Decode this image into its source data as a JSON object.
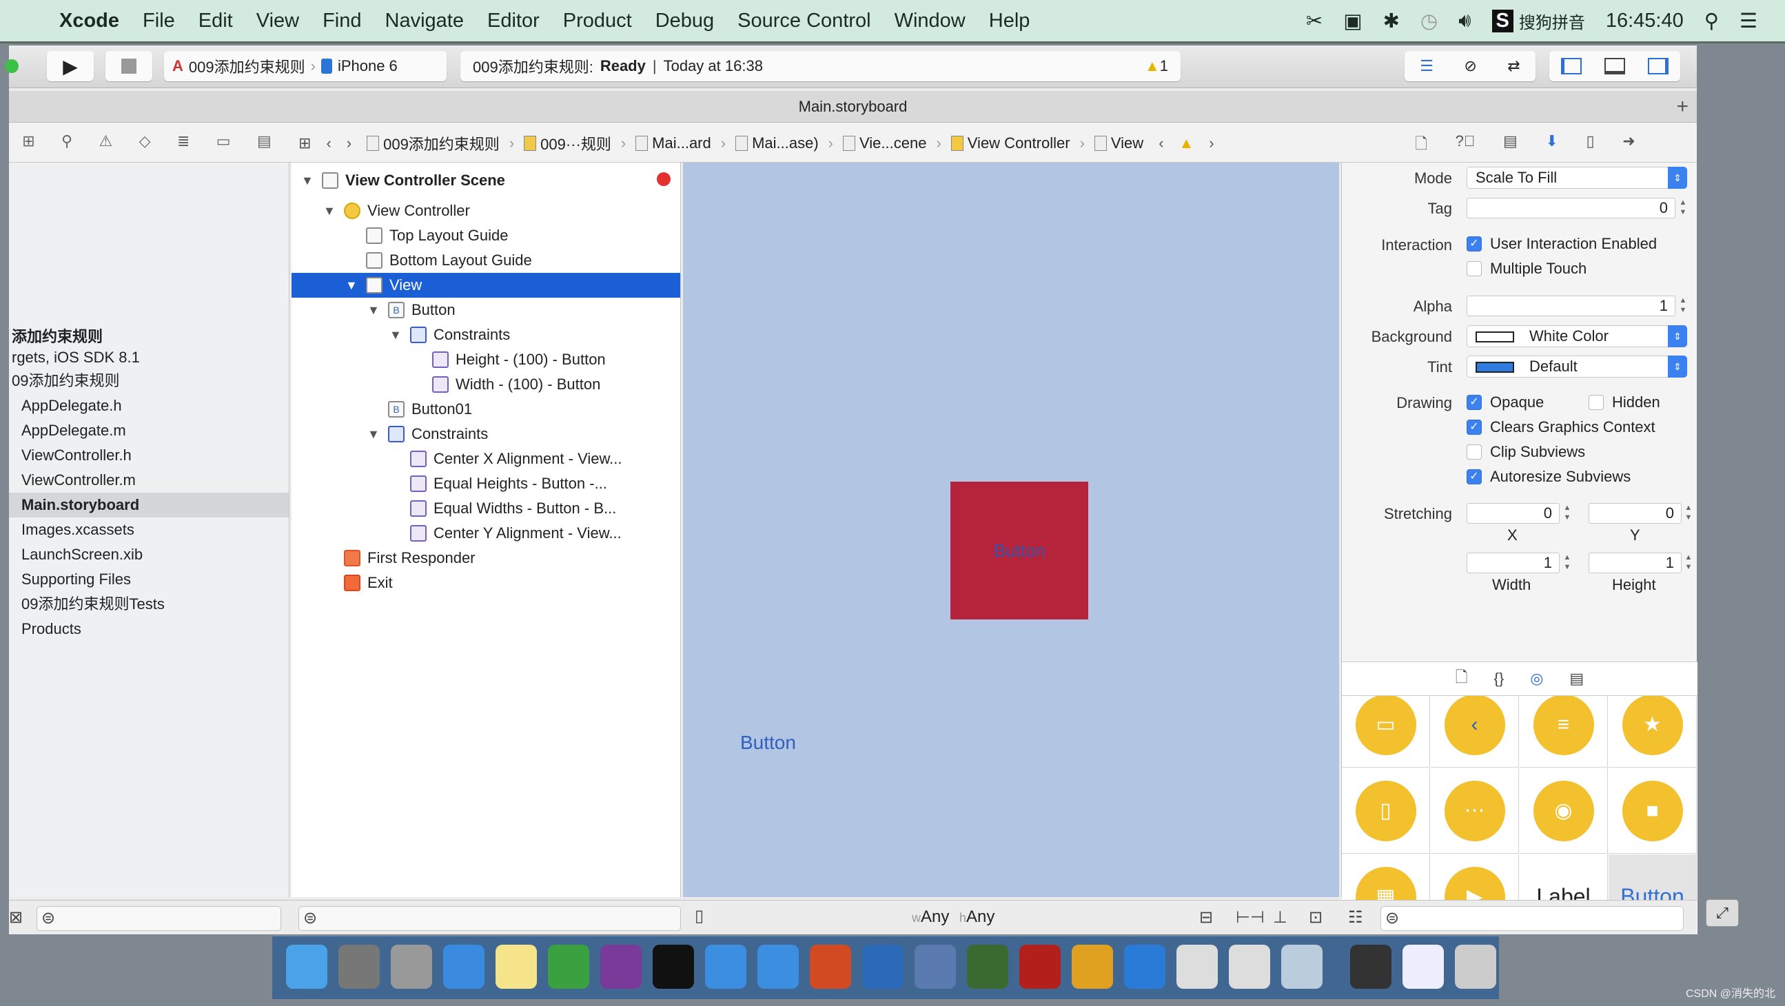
{
  "menubar": {
    "app": "Xcode",
    "items": [
      "File",
      "Edit",
      "View",
      "Find",
      "Navigate",
      "Editor",
      "Product",
      "Debug",
      "Source Control",
      "Window",
      "Help"
    ],
    "input_method": "搜狗拼音",
    "clock": "16:45:40",
    "status_icons": [
      "cut-icon",
      "camera-icon",
      "bluetooth-icon",
      "time-machine-icon",
      "volume-icon",
      "sogou-icon",
      "spotlight-icon",
      "notification-center-icon"
    ]
  },
  "toolbar": {
    "scheme": "009添加约束规则",
    "device": "iPhone 6",
    "status_project": "009添加约束规则:",
    "status_state": "Ready",
    "status_time": "Today at 16:38",
    "warning_count": "1"
  },
  "tab": {
    "title": "Main.storyboard",
    "add": "+"
  },
  "jumpbar": [
    "009添加约束规则",
    "009···规则",
    "Mai...ard",
    "Mai...ase)",
    "Vie...cene",
    "View Controller",
    "View"
  ],
  "navigator": {
    "items": [
      {
        "label": "添加约束规则",
        "bold": true
      },
      {
        "label": "rgets, iOS SDK 8.1"
      },
      {
        "label": "09添加约束规则"
      },
      {
        "label": "AppDelegate.h"
      },
      {
        "label": "AppDelegate.m"
      },
      {
        "label": "ViewController.h"
      },
      {
        "label": "ViewController.m"
      },
      {
        "label": "Main.storyboard",
        "selected": true
      },
      {
        "label": "Images.xcassets"
      },
      {
        "label": "LaunchScreen.xib"
      },
      {
        "label": "Supporting Files"
      },
      {
        "label": "09添加约束规则Tests"
      },
      {
        "label": "Products"
      }
    ]
  },
  "outline": {
    "items": [
      {
        "label": "View Controller Scene",
        "level": 0,
        "expanded": true,
        "icon": "scene",
        "bold": true
      },
      {
        "label": "View Controller",
        "level": 1,
        "expanded": true,
        "icon": "vc"
      },
      {
        "label": "Top Layout Guide",
        "level": 2,
        "icon": "guide"
      },
      {
        "label": "Bottom Layout Guide",
        "level": 2,
        "icon": "guide"
      },
      {
        "label": "View",
        "level": 2,
        "expanded": true,
        "icon": "view",
        "selected": true
      },
      {
        "label": "Button",
        "level": 3,
        "expanded": true,
        "icon": "button",
        "glyph": "B"
      },
      {
        "label": "Constraints",
        "level": 4,
        "expanded": true,
        "icon": "con"
      },
      {
        "label": "Height - (100) - Button",
        "level": 5,
        "icon": "cc"
      },
      {
        "label": "Width - (100) - Button",
        "level": 5,
        "icon": "cc"
      },
      {
        "label": "Button01",
        "level": 3,
        "icon": "button",
        "glyph": "B"
      },
      {
        "label": "Constraints",
        "level": 3,
        "expanded": true,
        "icon": "con"
      },
      {
        "label": "Center X Alignment - View...",
        "level": 4,
        "icon": "cc"
      },
      {
        "label": "Equal Heights - Button -...",
        "level": 4,
        "icon": "cc"
      },
      {
        "label": "Equal Widths - Button - B...",
        "level": 4,
        "icon": "cc"
      },
      {
        "label": "Center Y Alignment - View...",
        "level": 4,
        "icon": "cc"
      },
      {
        "label": "First Responder",
        "level": 1,
        "icon": "fr"
      },
      {
        "label": "Exit",
        "level": 1,
        "icon": "exit"
      }
    ]
  },
  "canvas": {
    "button_red_label": "Button",
    "button01_label": "Button",
    "size_class_w": "w",
    "size_class_w_value": "Any",
    "size_class_h": "h",
    "size_class_h_value": "Any",
    "red_color": "#b5243a"
  },
  "inspector": {
    "mode_label": "Mode",
    "mode_value": "Scale To Fill",
    "tag_label": "Tag",
    "tag_value": "0",
    "interaction_label": "Interaction",
    "user_interaction": {
      "label": "User Interaction Enabled",
      "checked": true
    },
    "multiple_touch": {
      "label": "Multiple Touch",
      "checked": false
    },
    "alpha_label": "Alpha",
    "alpha_value": "1",
    "background_label": "Background",
    "background_value": "White Color",
    "background_color": "#ffffff",
    "tint_label": "Tint",
    "tint_value": "Default",
    "tint_color": "#2f7be0",
    "drawing_label": "Drawing",
    "opaque": {
      "label": "Opaque",
      "checked": true
    },
    "hidden": {
      "label": "Hidden",
      "checked": false
    },
    "clears": {
      "label": "Clears Graphics Context",
      "checked": true
    },
    "clip": {
      "label": "Clip Subviews",
      "checked": false
    },
    "autoresize": {
      "label": "Autoresize Subviews",
      "checked": true
    },
    "stretching_label": "Stretching",
    "stretch_x": "0",
    "stretch_y": "0",
    "stretch_w": "1",
    "stretch_h": "1",
    "x_label": "X",
    "y_label": "Y",
    "width_label": "Width",
    "height_label": "Height"
  },
  "library": {
    "label_item": "Label",
    "button_item": "Button"
  },
  "watermark": "CSDN @消失的北"
}
